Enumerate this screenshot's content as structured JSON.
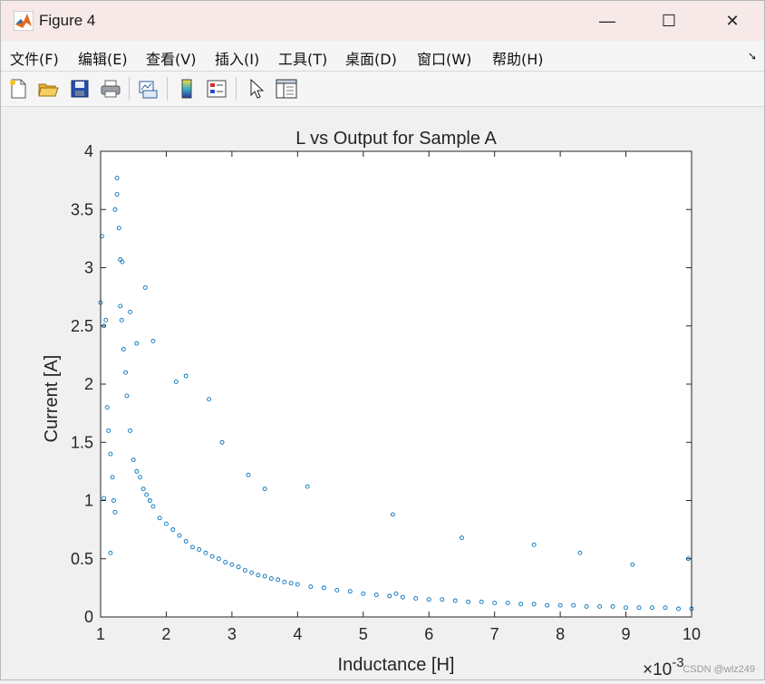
{
  "window": {
    "title": "Figure 4",
    "controls": {
      "minimize": "—",
      "maximize": "☐",
      "close": "✕"
    }
  },
  "menu": [
    {
      "label": "文件(F)"
    },
    {
      "label": "编辑(E)"
    },
    {
      "label": "查看(V)"
    },
    {
      "label": "插入(I)"
    },
    {
      "label": "工具(T)"
    },
    {
      "label": "桌面(D)"
    },
    {
      "label": "窗口(W)"
    },
    {
      "label": "帮助(H)"
    }
  ],
  "toolbar": [
    {
      "icon": "new-figure-icon"
    },
    {
      "icon": "open-file-icon"
    },
    {
      "icon": "save-icon"
    },
    {
      "icon": "print-icon"
    },
    {
      "icon": "link-plot-icon"
    },
    {
      "icon": "colorbar-icon"
    },
    {
      "icon": "legend-icon"
    },
    {
      "icon": "edit-pointer-icon"
    },
    {
      "icon": "property-inspector-icon"
    }
  ],
  "watermark": "CSDN @wlz249",
  "chart_data": {
    "type": "scatter",
    "title": "L vs Output for Sample A",
    "xlabel": "Inductance [H]",
    "ylabel": "Current [A]",
    "x_exponent_label": "×10",
    "x_exponent_power": "-3",
    "xlim": [
      1,
      10
    ],
    "ylim": [
      0,
      4
    ],
    "x_ticks": [
      "1",
      "2",
      "3",
      "4",
      "5",
      "6",
      "7",
      "8",
      "9",
      "10"
    ],
    "y_ticks": [
      "0",
      "0.5",
      "1",
      "1.5",
      "2",
      "2.5",
      "3",
      "3.5",
      "4"
    ],
    "marker": "circle (open)",
    "color": "#0072BD",
    "grid": false,
    "series": [
      {
        "x": [
          1.0,
          1.02,
          1.05,
          1.08,
          1.1,
          1.12,
          1.15,
          1.18,
          1.2,
          1.22,
          1.25,
          1.28,
          1.3,
          1.32,
          1.35,
          1.38,
          1.4,
          1.45,
          1.5,
          1.55,
          1.6,
          1.65,
          1.7,
          1.75,
          1.8,
          1.9,
          2.0,
          2.1,
          2.2,
          2.3,
          2.4,
          2.5,
          2.6,
          2.7,
          2.8,
          2.9,
          3.0,
          3.1,
          3.2,
          3.3,
          3.4,
          3.5,
          3.6,
          3.7,
          3.8,
          3.9,
          4.0,
          4.2,
          4.4,
          4.6,
          4.8,
          5.0,
          5.2,
          5.4,
          5.5,
          5.6,
          5.8,
          6.0,
          6.2,
          6.4,
          6.6,
          6.8,
          7.0,
          7.2,
          7.4,
          7.6,
          7.8,
          8.0,
          8.2,
          8.4,
          8.6,
          8.8,
          9.0,
          9.2,
          9.4,
          9.6,
          9.8,
          10.0,
          1.05,
          1.15,
          1.25,
          1.22,
          1.3,
          1.33,
          1.45,
          1.55,
          1.68,
          1.8,
          2.15,
          2.3,
          2.65,
          2.85,
          3.25,
          3.5,
          4.15,
          5.45,
          6.5,
          7.6,
          8.3,
          9.1,
          9.95
        ],
        "y": [
          2.7,
          3.27,
          2.5,
          2.55,
          1.8,
          1.6,
          1.4,
          1.2,
          1.0,
          0.9,
          3.77,
          3.34,
          3.07,
          2.55,
          2.3,
          2.1,
          1.9,
          1.6,
          1.35,
          1.25,
          1.2,
          1.1,
          1.05,
          1.0,
          0.95,
          0.85,
          0.8,
          0.75,
          0.7,
          0.65,
          0.6,
          0.58,
          0.55,
          0.52,
          0.5,
          0.47,
          0.45,
          0.43,
          0.4,
          0.38,
          0.36,
          0.35,
          0.33,
          0.32,
          0.3,
          0.29,
          0.28,
          0.26,
          0.25,
          0.23,
          0.22,
          0.2,
          0.19,
          0.18,
          0.2,
          0.17,
          0.16,
          0.15,
          0.15,
          0.14,
          0.13,
          0.13,
          0.12,
          0.12,
          0.11,
          0.11,
          0.1,
          0.1,
          0.1,
          0.09,
          0.09,
          0.09,
          0.08,
          0.08,
          0.08,
          0.08,
          0.07,
          0.07,
          1.02,
          0.55,
          3.63,
          3.5,
          2.67,
          3.05,
          2.62,
          2.35,
          2.83,
          2.37,
          2.02,
          2.07,
          1.87,
          1.5,
          1.22,
          1.1,
          1.12,
          0.88,
          0.68,
          0.62,
          0.55,
          0.45,
          0.5
        ]
      }
    ]
  }
}
